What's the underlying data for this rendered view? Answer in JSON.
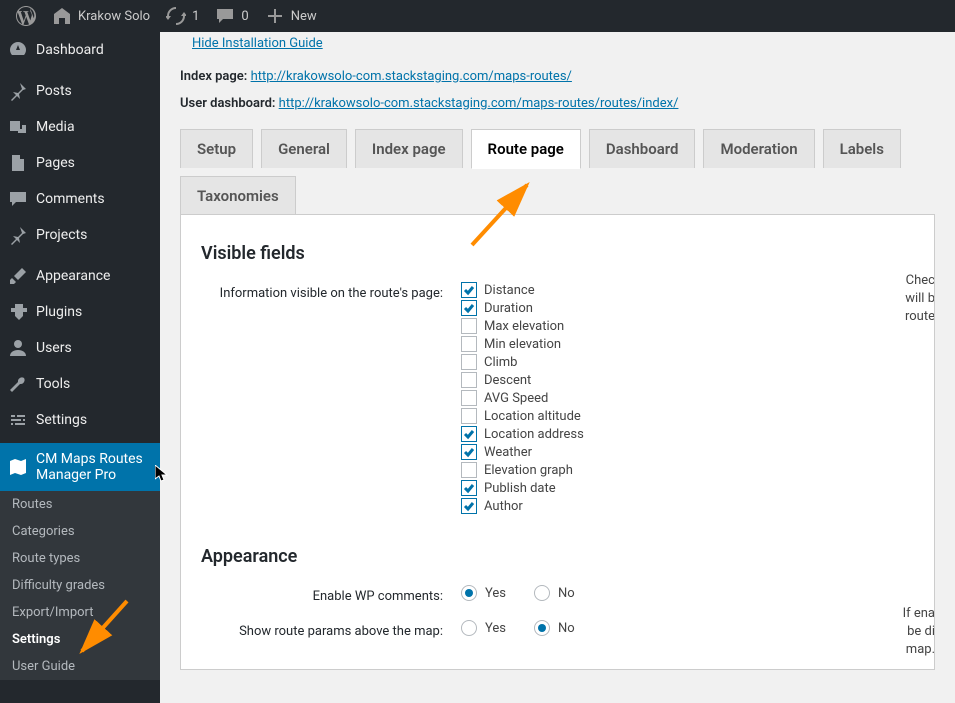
{
  "adminBar": {
    "siteName": "Krakow Solo",
    "refresh": "1",
    "comments": "0",
    "newLabel": "New"
  },
  "sidebar": {
    "dashboard": "Dashboard",
    "posts": "Posts",
    "media": "Media",
    "pages": "Pages",
    "comments": "Comments",
    "projects": "Projects",
    "appearance": "Appearance",
    "plugins": "Plugins",
    "users": "Users",
    "tools": "Tools",
    "settings": "Settings",
    "cmMaps": "CM Maps Routes Manager Pro",
    "submenu": {
      "routes": "Routes",
      "categories": "Categories",
      "routeTypes": "Route types",
      "difficulty": "Difficulty grades",
      "exportImport": "Export/Import",
      "settings": "Settings",
      "userGuide": "User Guide"
    }
  },
  "content": {
    "hideGuide": "Hide Installation Guide",
    "indexPageLabel": "Index page:",
    "indexPageUrl": "http://krakowsolo-com.stackstaging.com/maps-routes/",
    "userDashLabel": "User dashboard:",
    "userDashUrl": "http://krakowsolo-com.stackstaging.com/maps-routes/routes/index/"
  },
  "tabs": {
    "setup": "Setup",
    "general": "General",
    "indexPage": "Index page",
    "routePage": "Route page",
    "dashboard": "Dashboard",
    "moderation": "Moderation",
    "labels": "Labels",
    "taxonomies": "Taxonomies"
  },
  "sections": {
    "visibleFields": {
      "title": "Visible fields",
      "infoLabel": "Information visible on the route's page:",
      "help1": "Chec",
      "help2": "will b",
      "help3": "route",
      "options": [
        {
          "label": "Distance",
          "checked": true
        },
        {
          "label": "Duration",
          "checked": true
        },
        {
          "label": "Max elevation",
          "checked": false
        },
        {
          "label": "Min elevation",
          "checked": false
        },
        {
          "label": "Climb",
          "checked": false
        },
        {
          "label": "Descent",
          "checked": false
        },
        {
          "label": "AVG Speed",
          "checked": false
        },
        {
          "label": "Location altitude",
          "checked": false
        },
        {
          "label": "Location address",
          "checked": true
        },
        {
          "label": "Weather",
          "checked": true
        },
        {
          "label": "Elevation graph",
          "checked": false
        },
        {
          "label": "Publish date",
          "checked": true
        },
        {
          "label": "Author",
          "checked": true
        }
      ]
    },
    "appearance": {
      "title": "Appearance",
      "enableComments": "Enable WP comments:",
      "showParams": "Show route params above the map:",
      "yes": "Yes",
      "no": "No",
      "help1": "If ena",
      "help2": "be di",
      "help3": "map."
    }
  }
}
